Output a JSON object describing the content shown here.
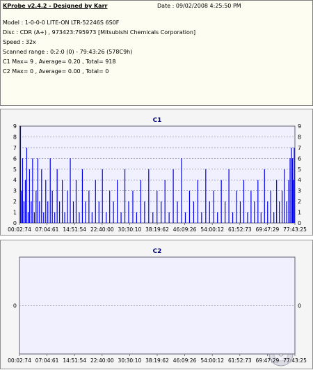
{
  "app": {
    "title": "KProbe v2.4.2 - Designed by Karr",
    "date": "Date : 09/02/2008 4:25:50 PM"
  },
  "info_lines": [
    "Model : 1-0-0-0 LITE-ON LTR-52246S        6S0F",
    "Disc : CDR (A+) , 973423:795973 [Mitsubishi Chemicals Corporation]",
    "Speed : 32x",
    "Scanned range : 0:2:0 (0) - 79:43:26 (578C9h)",
    "C1 Max= 9 , Average= 0.20 , Total= 918",
    "C2 Max= 0 , Average= 0.00 , Total= 0"
  ],
  "colors": {
    "plot_bg": "#f0f0ff",
    "bar": "#0000ee",
    "grid": "#8080a0",
    "title_color": "#000080"
  },
  "chart_data": [
    {
      "type": "bar",
      "title": "C1",
      "ylim": [
        0,
        9
      ],
      "yticks": [
        "0",
        "1",
        "2",
        "3",
        "4",
        "5",
        "6",
        "7",
        "8",
        "9"
      ],
      "xticks": [
        "00:02:74",
        "07:04:61",
        "14:51:54",
        "22:40:00",
        "30:30:10",
        "38:19:62",
        "46:09:26",
        "54:00:12",
        "61:52:73",
        "69:47:29",
        "77:43:25"
      ],
      "x_range_min": [
        0,
        79.7
      ],
      "series": [
        {
          "x_min": [
            0.3,
            0.6,
            0.9,
            1.3,
            1.7,
            2.1,
            2.5,
            2.9,
            3.4,
            3.8,
            4.3,
            4.8,
            5.3,
            5.8,
            6.4,
            7.0,
            7.6,
            8.2,
            8.9,
            9.5,
            10.2,
            10.9,
            11.6,
            12.4,
            13.1,
            13.9,
            14.7,
            15.6,
            16.4,
            17.3,
            18.2,
            19.1,
            20.1,
            21.0,
            22.0,
            23.0,
            24.0,
            25.1,
            26.1,
            27.2,
            28.3,
            29.4,
            30.5,
            31.6,
            32.8,
            33.9,
            35.1,
            36.2,
            37.4,
            38.6,
            39.8,
            41.0,
            42.1,
            43.3,
            44.5,
            45.7,
            46.9,
            48.0,
            49.2,
            50.4,
            51.6,
            52.7,
            53.9,
            55.0,
            56.2,
            57.3,
            58.4,
            59.5,
            60.6,
            61.7,
            62.8,
            63.9,
            64.9,
            66.0,
            67.0,
            68.0,
            69.0,
            69.9,
            70.9,
            71.8,
            72.7,
            73.6,
            74.4,
            75.2,
            76.0,
            76.7,
            77.3,
            77.9,
            78.3,
            78.7,
            79.0,
            79.3,
            79.5
          ],
          "values": [
            9,
            3,
            6,
            2,
            4,
            7,
            1,
            5,
            2,
            6,
            1,
            3,
            6,
            2,
            5,
            1,
            4,
            2,
            6,
            3,
            1,
            5,
            2,
            4,
            1,
            3,
            6,
            2,
            4,
            1,
            5,
            2,
            3,
            1,
            4,
            2,
            5,
            1,
            3,
            2,
            4,
            1,
            5,
            2,
            3,
            1,
            4,
            2,
            5,
            1,
            3,
            2,
            4,
            1,
            5,
            2,
            6,
            1,
            3,
            2,
            4,
            1,
            5,
            2,
            3,
            1,
            4,
            2,
            5,
            1,
            3,
            2,
            4,
            1,
            3,
            2,
            4,
            1,
            5,
            2,
            3,
            1,
            4,
            2,
            3,
            5,
            2,
            4,
            6,
            7,
            6,
            4,
            7
          ]
        }
      ]
    },
    {
      "type": "bar",
      "title": "C2",
      "ylim": [
        0,
        0
      ],
      "yticks": [
        "0"
      ],
      "xticks": [
        "00:02:74",
        "07:04:61",
        "14:51:54",
        "22:40:00",
        "30:30:10",
        "38:19:62",
        "46:09:26",
        "54:00:12",
        "61:52:73",
        "69:47:29",
        "77:43:25"
      ],
      "series": [
        {
          "x_min": [],
          "values": []
        }
      ]
    }
  ]
}
